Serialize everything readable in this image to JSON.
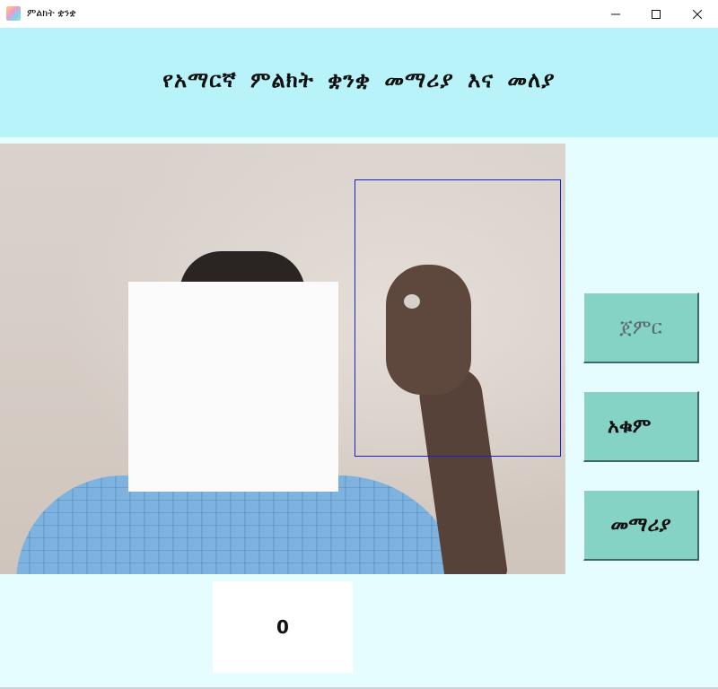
{
  "window": {
    "title": "ምልክት ቋንቋ",
    "controls": {
      "minimize_icon": "minimize-icon",
      "maximize_icon": "maximize-icon",
      "close_icon": "close-icon"
    }
  },
  "header": {
    "title": "የአማርኛ ምልክት ቋንቋ መማሪያ እና መለያ"
  },
  "buttons": {
    "start_label": "ጀምር",
    "stop_label": "አቁም",
    "help_label": "መማሪያ"
  },
  "output": {
    "value": "0"
  },
  "colors": {
    "header_bg": "#b8f3f9",
    "body_bg": "#e6fdff",
    "button_bg": "#84d3c5",
    "detection_box": "#1a22c0"
  }
}
